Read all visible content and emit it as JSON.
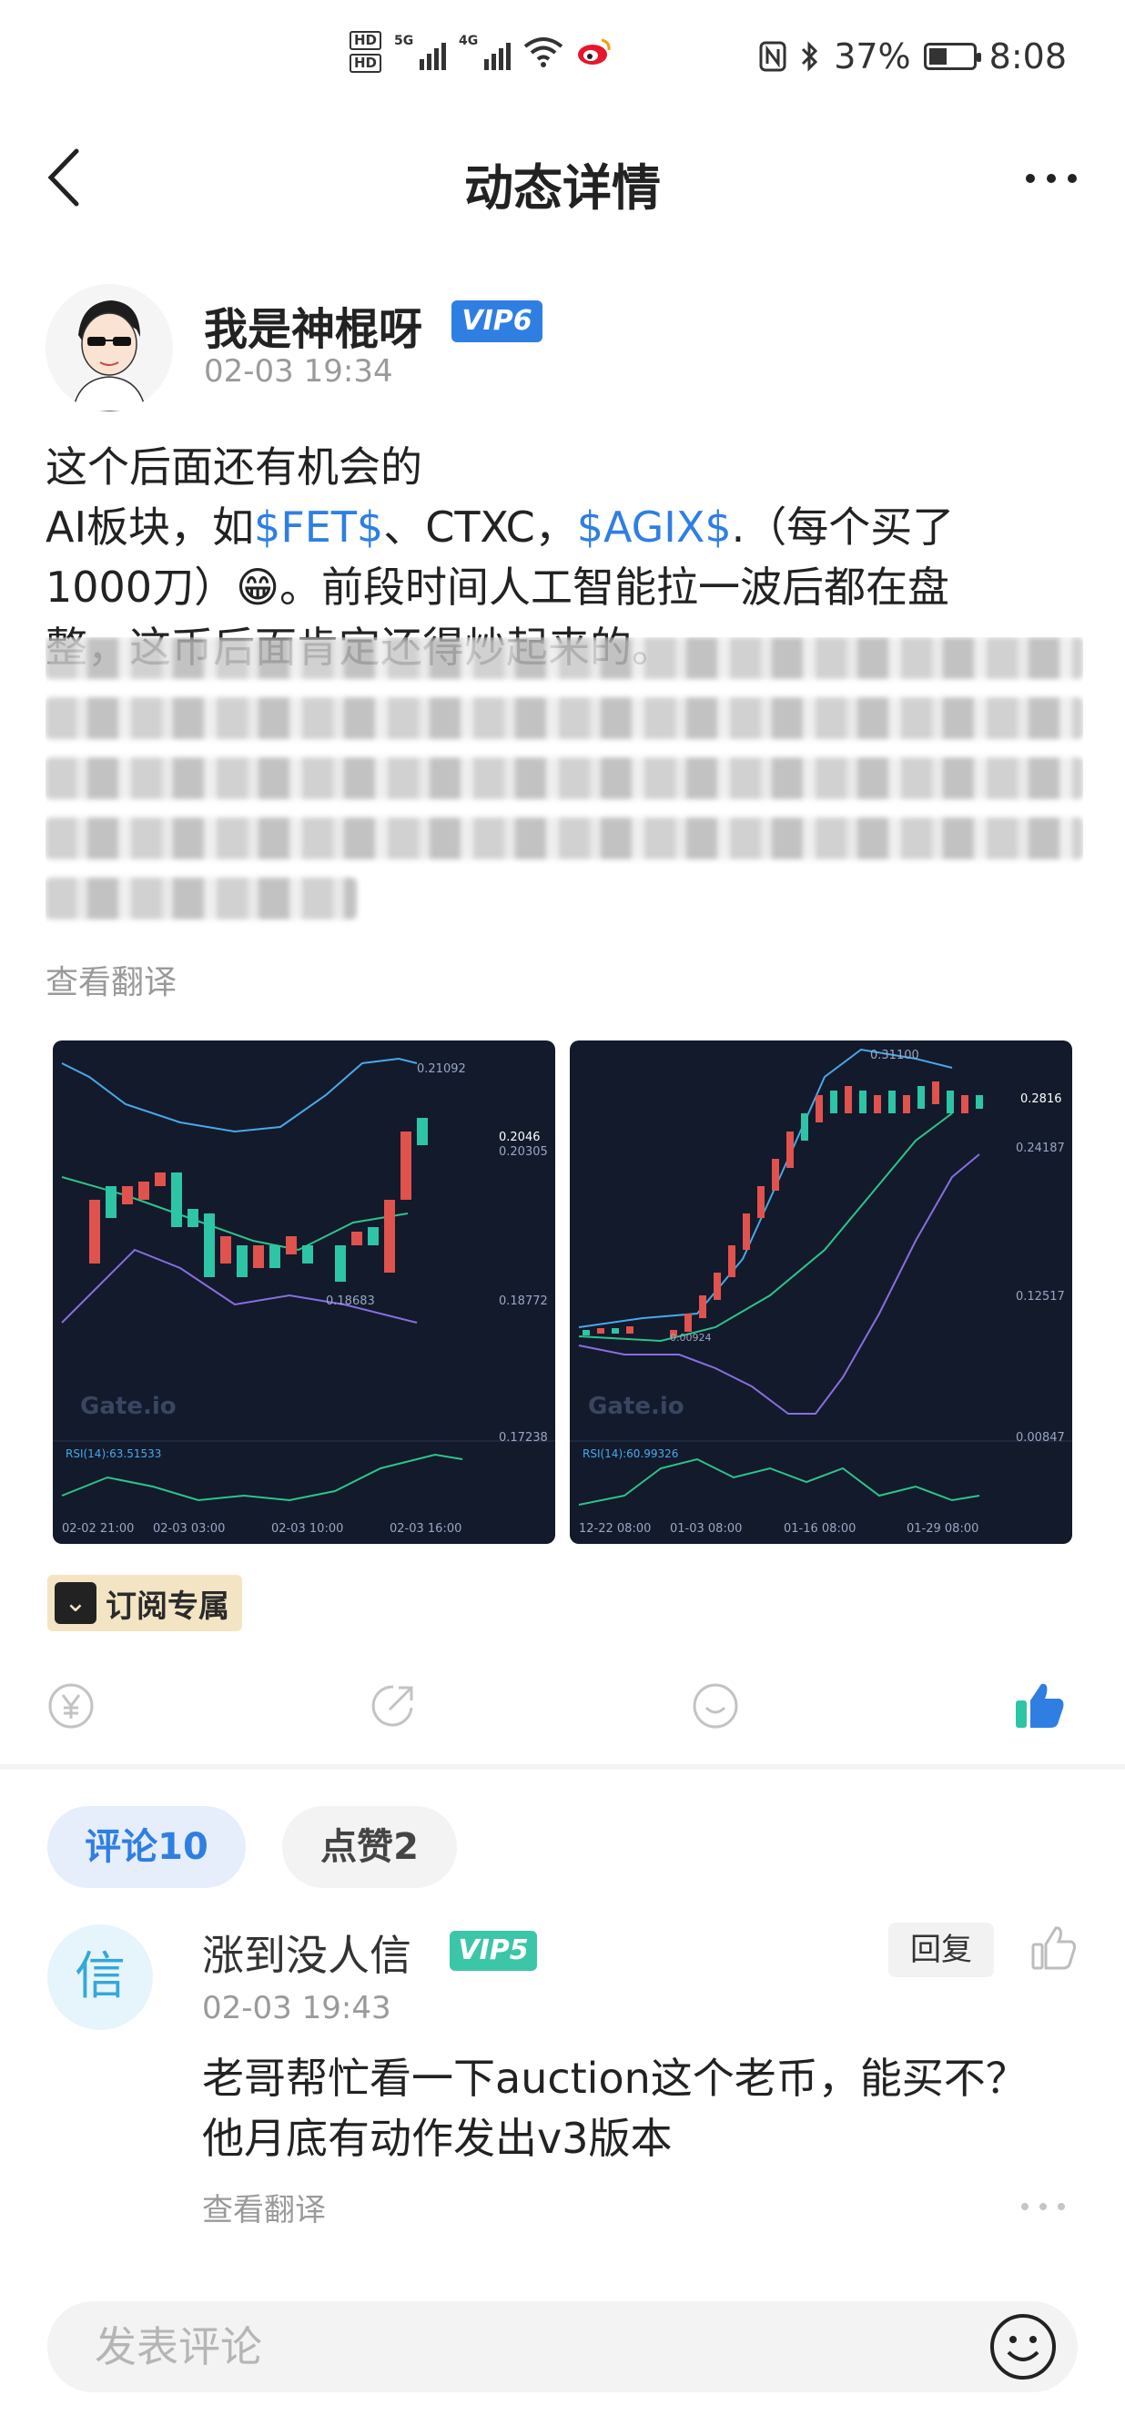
{
  "status_bar": {
    "hd1": "HD",
    "hd2": "HD",
    "net1": "5G",
    "net2": "4G",
    "battery_percent": "37%",
    "battery_level": 0.37,
    "time": "8:08"
  },
  "nav": {
    "title": "动态详情"
  },
  "post": {
    "author": "我是神棍呀",
    "author_vip": "VIP6",
    "time": "02-03 19:34",
    "line1": "这个后面还有机会的",
    "line2_a": "AI板块，如",
    "tag1": "$FET$",
    "line2_b": "、CTXC，",
    "tag2": "$AGIX$",
    "line2_c": ".（每个买了",
    "line3": "1000刀）😁。前段时间人工智能拉一波后都在盘",
    "line4": "整，这币后面肯定还得炒起来的。",
    "see_translation": "查看翻译",
    "subscription_badge": "订阅专属"
  },
  "charts": [
    {
      "watermark": "Gate.io",
      "price_high": "0.21092",
      "price_current": "0.2046",
      "price_mid": "0.20305",
      "price_low_mark": "0.18683",
      "axis_labels": [
        "0.18772",
        "0.17238"
      ],
      "rsi_label": "RSI(14):63.51533",
      "x_labels": [
        "02-02 21:00",
        "02-03 03:00",
        "02-03 10:00",
        "02-03 16:00"
      ]
    },
    {
      "watermark": "Gate.io",
      "price_high": "0.31100",
      "price_current": "0.2816",
      "price_low_mark": "0.00924",
      "axis_labels": [
        "0.24187",
        "0.12517",
        "0.00847"
      ],
      "rsi_label": "RSI(14):60.99326",
      "x_labels": [
        "12-22 08:00",
        "01-03 08:00",
        "01-16 08:00",
        "01-29 08:00"
      ]
    }
  ],
  "tabs": {
    "comments": "评论10",
    "likes": "点赞2"
  },
  "comment": {
    "avatar_char": "信",
    "user": "涨到没人信",
    "vip": "VIP5",
    "reply": "回复",
    "time": "02-03 19:43",
    "text": "老哥帮忙看一下auction这个老币，能买不？他月底有动作发出v3版本",
    "see_translation": "查看翻译"
  },
  "input": {
    "placeholder": "发表评论"
  },
  "colors": {
    "accent": "#2f7fe3",
    "vip5": "#3cc6a8",
    "chart_bg": "#121a2c",
    "candle_up": "#2ec4a6",
    "candle_down": "#e0524c"
  }
}
